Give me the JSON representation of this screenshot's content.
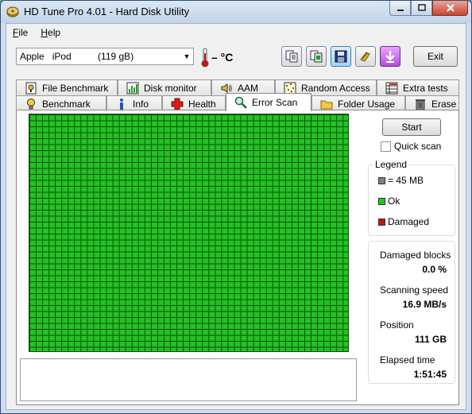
{
  "window": {
    "title": "HD Tune Pro 4.01 - Hard Disk Utility"
  },
  "menu": [
    {
      "label": "File",
      "hot": "F",
      "rest": "ile"
    },
    {
      "label": "Help",
      "hot": "H",
      "rest": "elp"
    }
  ],
  "toolbar": {
    "drive_label": "Apple   iPod          (119 gB)",
    "temperature": "– °C",
    "buttons": [
      "copy-info-icon",
      "copy-screenshot-icon",
      "save-icon",
      "options-icon",
      "download-icon"
    ],
    "exit_label": "Exit"
  },
  "tabs_top": [
    {
      "label": "File Benchmark",
      "icon": "file-benchmark-icon"
    },
    {
      "label": "Disk monitor",
      "icon": "disk-monitor-icon"
    },
    {
      "label": "AAM",
      "icon": "speaker-icon"
    },
    {
      "label": "Random Access",
      "icon": "random-access-icon"
    },
    {
      "label": "Extra tests",
      "icon": "extra-tests-icon"
    }
  ],
  "tabs_bottom": [
    {
      "label": "Benchmark",
      "icon": "benchmark-icon"
    },
    {
      "label": "Info",
      "icon": "info-icon"
    },
    {
      "label": "Health",
      "icon": "health-icon"
    },
    {
      "label": "Error Scan",
      "icon": "magnifier-icon",
      "active": true
    },
    {
      "label": "Folder Usage",
      "icon": "folder-icon"
    },
    {
      "label": "Erase",
      "icon": "trash-icon"
    }
  ],
  "error_scan": {
    "start_label": "Start",
    "quick_scan_label": "Quick scan",
    "quick_scan_checked": false,
    "legend": {
      "title": "Legend",
      "items": [
        {
          "label": "= 45 MB",
          "color": "#7f7f7f"
        },
        {
          "label": "Ok",
          "color": "#22c322"
        },
        {
          "label": "Damaged",
          "color": "#d01010"
        }
      ]
    },
    "stats": [
      {
        "label": "Damaged blocks",
        "value": "0.0 %"
      },
      {
        "label": "Scanning speed",
        "value": "16.9 MB/s"
      },
      {
        "label": "Position",
        "value": "111 GB"
      },
      {
        "label": "Elapsed time",
        "value": "1:51:45"
      }
    ],
    "block_state": "ok"
  }
}
